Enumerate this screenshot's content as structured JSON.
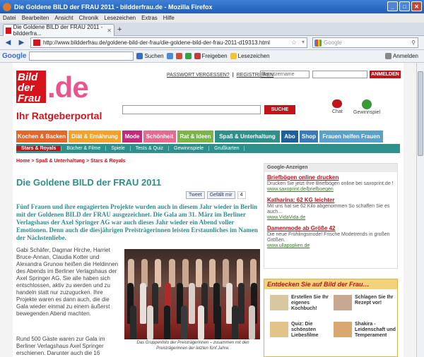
{
  "window": {
    "title": "Die Goldene BILD der FRAU 2011 - bildderfrau.de - Mozilla Firefox"
  },
  "menu": [
    "Datei",
    "Bearbeiten",
    "Ansicht",
    "Chronik",
    "Lesezeichen",
    "Extras",
    "Hilfe"
  ],
  "tab": {
    "label": "Die Goldene BILD der FRAU 2011 - bildderfra...",
    "new": "+"
  },
  "nav": {
    "url": "http://www.bildderfrau.de/goldene-bild-der-frau/die-goldene-bild-der-frau-2011-d19313.html",
    "search_placeholder": "Google"
  },
  "gtoolbar": {
    "logo": "Google",
    "suchen": "Suchen",
    "freigeben": "Freigeben",
    "lesezeichen": "Lesezeichen",
    "anmelden": "Anmelden"
  },
  "site": {
    "toplinks": {
      "passwort": "PASSWORT VERGESSEN?",
      "sep": "|",
      "registrieren": "REGISTRIEREN"
    },
    "user_placeholder": "Benutzername",
    "anmelden_btn": "ANMELDEN",
    "logo": {
      "bild": "Bild der Frau",
      "de": ".de",
      "tagline": "Ihr Ratgeberportal"
    },
    "suche_btn": "SUCHE",
    "chat": "Chat",
    "gewinnspiel": "Gewinnspiel",
    "mainnav": [
      {
        "label": "Kochen & Backen",
        "color": "#e2672a"
      },
      {
        "label": "Diät & Ernährung",
        "color": "#f2a22c"
      },
      {
        "label": "Mode",
        "color": "#c42a7a"
      },
      {
        "label": "Schönheit",
        "color": "#e46a90"
      },
      {
        "label": "Rat & Ideen",
        "color": "#7ab44a"
      },
      {
        "label": "Spaß & Unterhaltung",
        "color": "#2f8f8a"
      },
      {
        "label": "Abo",
        "color": "#1f5f9a"
      },
      {
        "label": "Shop",
        "color": "#3a7ab8"
      },
      {
        "label": "Frauen helfen Frauen",
        "color": "#5aa0c8"
      }
    ],
    "subnav": [
      "Stars & Royals",
      "Bücher & Filme",
      "Spiele",
      "Tests & Quiz",
      "Gewinnspiele",
      "Grußkarten"
    ],
    "breadcrumb": "Home > Spaß & Unterhaltung > Stars & Royals",
    "headline": "Die Goldene BILD der FRAU 2011",
    "share": {
      "tweet": "Tweet",
      "fb": "Gefällt mir",
      "fb_count": "4"
    },
    "lead": "Fünf Frauen und ihre engagierten Projekte wurden auch in diesem Jahr wieder in Berlin mit der Goldenen BILD der FRAU ausgezeichnet. Die Gala am 31. März im Berliner Verlagshaus der Axel Springer AG war auch dieses Jahr wieder ein Abend voller Emotionen. Denn auch die diesjährigen Preisträgerinnen leisten Erstaunliches im Namen der Nächstenliebe.",
    "body1": "Gabi Schäfer, Dagmar Hirche, Harriet Bruce-Annan, Claudia Kotter und Alexandra Grunow heißen die Heldinnen des Abends im Berliner Verlagshaus der Axel Springer AG. Sie alle haben sich entschlossen, aktiv zu werden und zu handeln statt nur zuzugucken. Ihre Projekte waren es dann auch, die die Gala wieder einmal zu einem äußerst bewegenden Abend machten.",
    "body2": "Rund 500 Gäste waren zur Gala im Berliner Verlagshaus Axel Springer erschienen. Darunter auch die 16",
    "caption": "Das Gruppenfoto der Preisträgerinnen – zusammen mit den Preisträgerinnen der letzten fünf Jahre.",
    "ads": {
      "heading": "Google-Anzeigen",
      "items": [
        {
          "title": "Briefbögen online drucken",
          "desc": "Drucken Sie jetzt Ihre Briefbögen online bei saxoprint.de !",
          "link": "www.saxoprint.de/briefboegen"
        },
        {
          "title": "Katharina: 62 KG leichter",
          "desc": "Mit uns hat sie 62 Kilo abgenommen So schaffen Sie es auch…",
          "link": "www.VidaVida.de"
        },
        {
          "title": "Damenmode ab Größe 42",
          "desc": "Die neue Frühlingsmode! Frische Modetrends in großen Größen.",
          "link": "www.ullapopken.de"
        }
      ]
    },
    "entdecken": {
      "heading": "Entdecken Sie auf Bild der Frau…",
      "items": [
        {
          "label": "Erstellen Sie Ihr eigenes Kochbuch!"
        },
        {
          "label": "Schlagen Sie Ihr Rezept vor!"
        },
        {
          "label": "Quiz: Die schönsten Liebesfilme"
        },
        {
          "label": "Shakira - Leidenschaft und Temperament"
        }
      ]
    }
  }
}
